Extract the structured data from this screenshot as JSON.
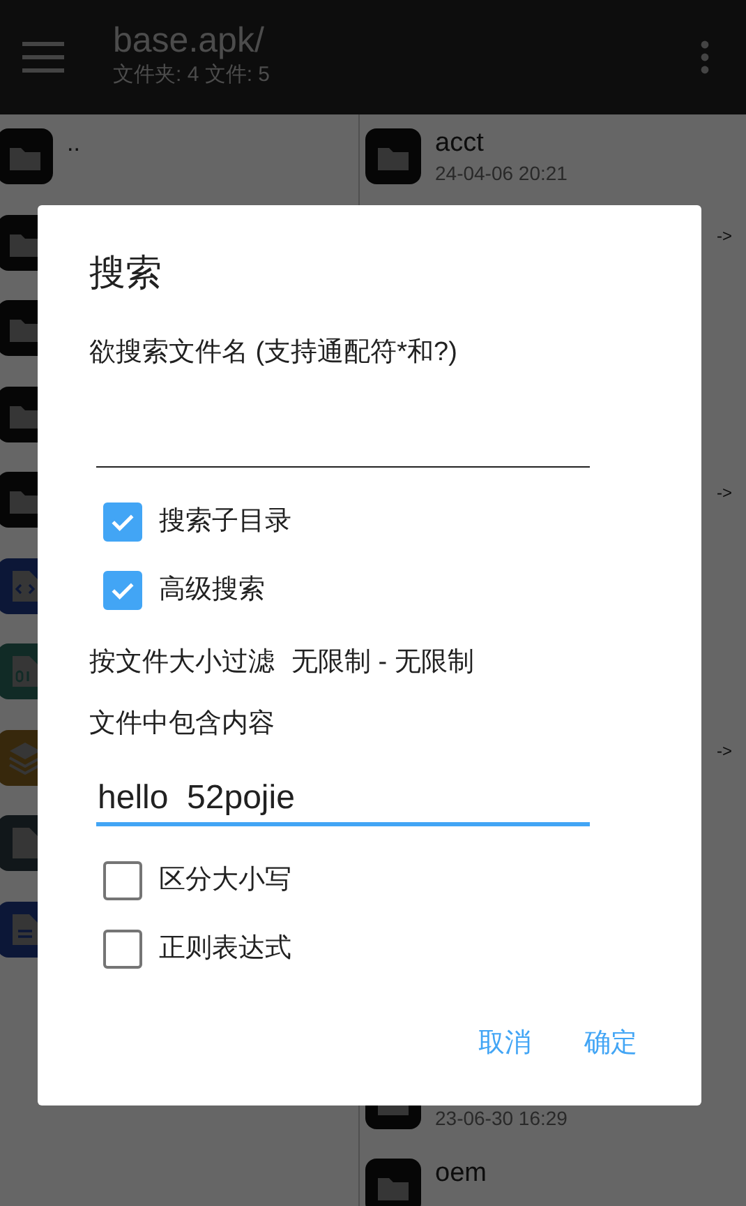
{
  "app_bar": {
    "title": "base.apk/",
    "subtitle": "文件夹: 4  文件: 5"
  },
  "left_pane": {
    "rows": [
      {
        "kind": "folder",
        "name": ".."
      },
      {
        "kind": "folder"
      },
      {
        "kind": "folder"
      },
      {
        "kind": "folder"
      },
      {
        "kind": "folder"
      },
      {
        "kind": "code"
      },
      {
        "kind": "binary"
      },
      {
        "kind": "layers"
      },
      {
        "kind": "file"
      },
      {
        "kind": "text"
      }
    ]
  },
  "right_pane": {
    "rows": [
      {
        "kind": "folder",
        "name": "acct",
        "date": "24-04-06 20:21"
      },
      {
        "kind": "symlink",
        "arrow": "->"
      },
      {
        "kind": "covered"
      },
      {
        "kind": "covered"
      },
      {
        "kind": "symlink",
        "arrow": "->"
      },
      {
        "kind": "covered"
      },
      {
        "kind": "covered"
      },
      {
        "kind": "symlink",
        "arrow": "->"
      },
      {
        "kind": "covered"
      },
      {
        "kind": "covered"
      },
      {
        "kind": "covered"
      },
      {
        "kind": "folder",
        "date": "23-06-30 16:29"
      },
      {
        "kind": "folder",
        "name": "oem"
      }
    ]
  },
  "dialog": {
    "title": "搜索",
    "name_label": "欲搜索文件名 (支持通配符*和?)",
    "options": [
      {
        "label": "搜索子目录",
        "checked": true
      },
      {
        "label": "高级搜索",
        "checked": true
      }
    ],
    "size_filter": {
      "label": "按文件大小过滤",
      "value": "无限制 - 无限制"
    },
    "content_label": "文件中包含内容",
    "content_value": "hello  52pojie",
    "content_options": [
      {
        "label": "区分大小写",
        "checked": false
      },
      {
        "label": "正则表达式",
        "checked": false
      }
    ],
    "buttons": [
      "取消",
      "确定"
    ]
  }
}
